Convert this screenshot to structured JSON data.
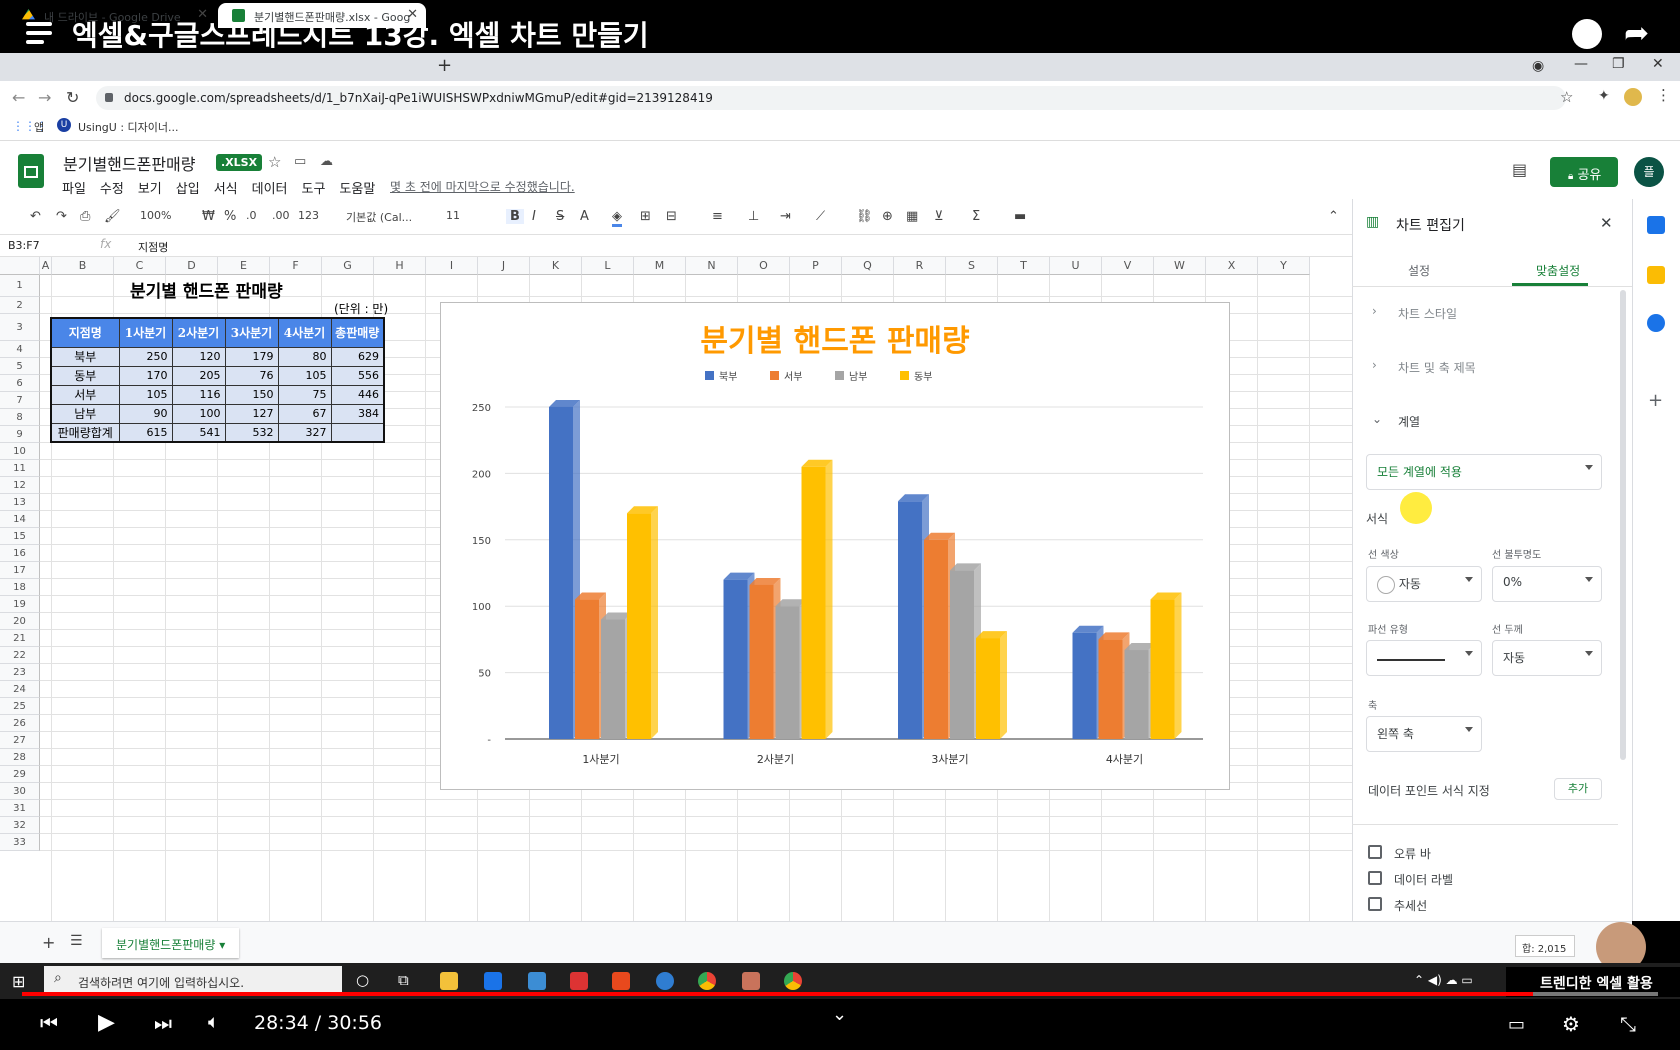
{
  "video": {
    "title": "엑셀&구글스프레드시트 13강. 엑셀 차트 만들기",
    "time": "28:34 / 30:56",
    "progress": 0.9235
  },
  "browser": {
    "tabs": [
      {
        "label": "내 드라이브 - Google Drive"
      },
      {
        "label": "분기별핸드폰판매량.xlsx - Goog"
      }
    ],
    "url": "docs.google.com/spreadsheets/d/1_b7nXaiJ-qPe1iWUISHSWPxdniwMGmuP/edit#gid=2139128419",
    "bookmarks": {
      "apps": "앱",
      "usingu": "UsingU : 디자이너..."
    }
  },
  "doc": {
    "title": "분기별핸드폰판매량",
    "format_badge": ".XLSX",
    "menu": [
      "파일",
      "수정",
      "보기",
      "삽입",
      "서식",
      "데이터",
      "도구",
      "도움말"
    ],
    "last_edit": "몇 초 전에 마지막으로 수정했습니다.",
    "share_label": "공유",
    "avatar_initial": "플"
  },
  "toolbar": {
    "zoom": "100%",
    "currency": "₩",
    "percent": "%",
    "dec_minus": ".0",
    "dec_plus": ".00",
    "format_more": "123",
    "font": "기본값 (Cal...",
    "font_size": "11"
  },
  "formula_bar": {
    "cell_ref": "B3:F7",
    "fx": "fx",
    "content": "지점명"
  },
  "grid": {
    "columns": [
      "A",
      "B",
      "C",
      "D",
      "E",
      "F",
      "G",
      "H",
      "I",
      "J",
      "K",
      "L",
      "M",
      "N",
      "O",
      "P",
      "Q",
      "R",
      "S",
      "T",
      "U",
      "V",
      "W",
      "X",
      "Y"
    ],
    "rows": [
      "1",
      "2",
      "3",
      "4",
      "5",
      "6",
      "7",
      "8",
      "9",
      "10",
      "11",
      "12",
      "13",
      "14",
      "15",
      "16",
      "17",
      "18",
      "19",
      "20",
      "21",
      "22",
      "23",
      "24",
      "25",
      "26",
      "27",
      "28",
      "29",
      "30",
      "31",
      "32",
      "33"
    ]
  },
  "sheet_table": {
    "title": "분기별 핸드폰 판매량",
    "unit": "(단위 : 만)",
    "headers": [
      "지점명",
      "1사분기",
      "2사분기",
      "3사분기",
      "4사분기",
      "총판매량"
    ],
    "rows": [
      {
        "name": "북부",
        "q1": "250",
        "q2": "120",
        "q3": "179",
        "q4": "80",
        "total": "629"
      },
      {
        "name": "동부",
        "q1": "170",
        "q2": "205",
        "q3": "76",
        "q4": "105",
        "total": "556"
      },
      {
        "name": "서부",
        "q1": "105",
        "q2": "116",
        "q3": "150",
        "q4": "75",
        "total": "446"
      },
      {
        "name": "남부",
        "q1": "90",
        "q2": "100",
        "q3": "127",
        "q4": "67",
        "total": "384"
      },
      {
        "name": "판매량합계",
        "q1": "615",
        "q2": "541",
        "q3": "532",
        "q4": "327",
        "total": ""
      }
    ]
  },
  "chart_data": {
    "type": "bar",
    "title": "분기별 핸드폰 판매량",
    "categories": [
      "1사분기",
      "2사분기",
      "3사분기",
      "4사분기"
    ],
    "series": [
      {
        "name": "북부",
        "color": "#4472c4",
        "values": [
          250,
          120,
          179,
          80
        ]
      },
      {
        "name": "서부",
        "color": "#ed7d31",
        "values": [
          105,
          116,
          150,
          75
        ]
      },
      {
        "name": "남부",
        "color": "#a5a5a5",
        "values": [
          90,
          100,
          127,
          67
        ]
      },
      {
        "name": "동부",
        "color": "#ffc000",
        "values": [
          170,
          205,
          76,
          105
        ]
      }
    ],
    "yticks": [
      "250",
      "200",
      "150",
      "100",
      "50",
      "-"
    ],
    "ylim": [
      0,
      250
    ],
    "grid": true,
    "legend": "top"
  },
  "panel": {
    "title": "차트 편집기",
    "tabs": {
      "setup": "설정",
      "customize": "맞춤설정"
    },
    "sections": {
      "style": "차트 스타일",
      "titles": "차트 및 축 제목",
      "series": "계열"
    },
    "apply_to": "모든 계열에 적용",
    "format_label": "서식",
    "line_color_label": "선 색상",
    "line_color_value": "자동",
    "line_opacity_label": "선 불투명도",
    "line_opacity_value": "0%",
    "dash_label": "파선 유형",
    "thickness_label": "선 두께",
    "thickness_value": "자동",
    "axis_label": "축",
    "axis_value": "왼쪽 축",
    "datapoint_label": "데이터 포인트 서식 지정",
    "add_label": "추가",
    "checkboxes": [
      "오류 바",
      "데이터 라벨",
      "추세선"
    ]
  },
  "sheet_tabs": {
    "active": "분기별핸드폰판매량",
    "sum": "합: 2,015"
  },
  "taskbar": {
    "search_placeholder": "검색하려면 여기에 입력하십시오.",
    "brand": "트렌디한 엑셀 활용"
  },
  "colors": {
    "sheets_green": "#188038",
    "header_blue": "#4a86e8",
    "title_orange": "#ff9900"
  }
}
